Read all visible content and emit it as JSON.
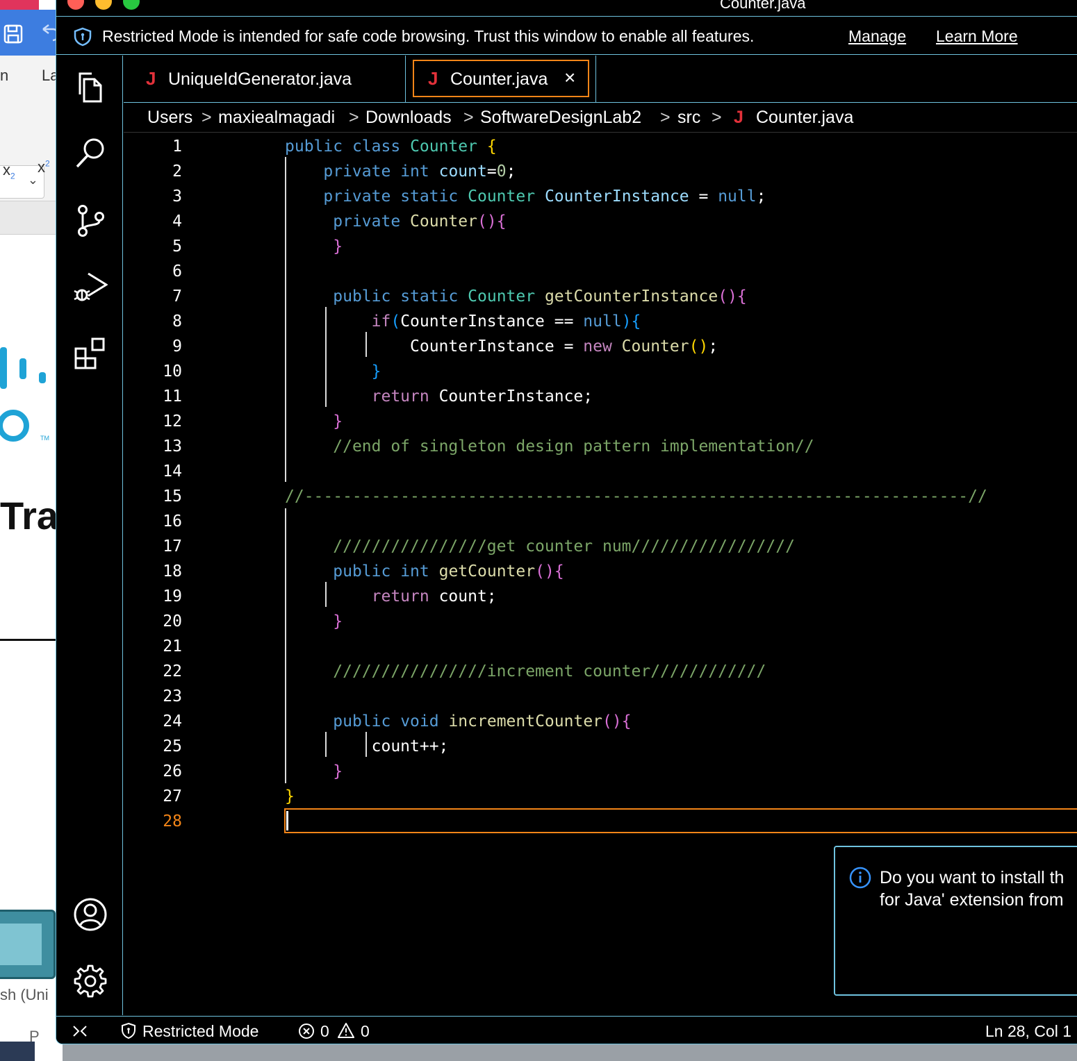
{
  "window": {
    "title": "Counter.java"
  },
  "banner": {
    "message": "Restricted Mode is intended for safe code browsing. Trust this window to enable all features.",
    "manage": "Manage",
    "learn_more": "Learn More"
  },
  "background_app": {
    "frag_n": "n",
    "frag_la": "La",
    "frag_x2sub": "x",
    "frag_sub": "2",
    "frag_x2sup": "x",
    "frag_sup": "2",
    "frag_tm": "TM",
    "frag_tra": "Tra",
    "frag_sh": "sh (Uni",
    "frag_p": "P"
  },
  "tabs": [
    {
      "icon": "J",
      "label": "UniqueIdGenerator.java",
      "active": false
    },
    {
      "icon": "J",
      "label": "Counter.java",
      "active": true,
      "close": "×"
    }
  ],
  "breadcrumb": {
    "items": [
      "Users",
      "maxiealmagadi",
      "Downloads",
      "SoftwareDesignLab2",
      "src"
    ],
    "file_icon": "J",
    "file": "Counter.java",
    "separator": ">"
  },
  "editor": {
    "line_numbers": [
      "1",
      "2",
      "3",
      "4",
      "5",
      "6",
      "7",
      "8",
      "9",
      "10",
      "11",
      "12",
      "13",
      "14",
      "15",
      "16",
      "17",
      "18",
      "19",
      "20",
      "21",
      "22",
      "23",
      "24",
      "25",
      "26",
      "27",
      "28"
    ],
    "current_line": "28",
    "lines": [
      "public class Counter {",
      "    private int count=0;",
      "    private static Counter CounterInstance = null;",
      "     private Counter(){",
      "     }",
      "",
      "     public static Counter getCounterInstance(){",
      "         if(CounterInstance == null){",
      "             CounterInstance = new Counter();",
      "         }",
      "         return CounterInstance;",
      "     }",
      "     //end of singleton design pattern implementation//",
      "",
      "//---------------------------------------------------------------------//",
      "",
      "     ////////////////get counter num/////////////////",
      "     public int getCounter(){",
      "         return count;",
      "     }",
      "",
      "     ////////////////increment counter////////////",
      "",
      "     public void incrementCounter(){",
      "         count++;",
      "     }",
      "}",
      ""
    ]
  },
  "notification": {
    "line1": "Do you want to install th",
    "line2": "for Java' extension from"
  },
  "status": {
    "restricted": "Restricted Mode",
    "errors": "0",
    "warnings": "0",
    "position": "Ln 28, Col 1"
  },
  "colors": {
    "accent_border": "#6fc3df",
    "active_tab": "#f38518",
    "java_icon": "#e2313a"
  }
}
